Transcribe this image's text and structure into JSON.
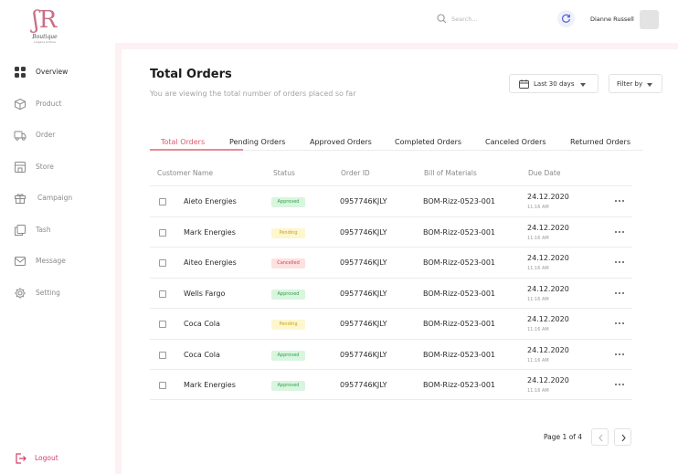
{
  "brand": {
    "name": "Boutique",
    "tagline": "Lingerie & More"
  },
  "header": {
    "search_placeholder": "Search...",
    "user_name": "Dianne Russell"
  },
  "sidebar": {
    "items": [
      {
        "label": "Overview",
        "icon": "grid-icon",
        "active": true
      },
      {
        "label": "Product",
        "icon": "box-icon",
        "active": false
      },
      {
        "label": "Order",
        "icon": "truck-icon",
        "active": false
      },
      {
        "label": "Store",
        "icon": "store-icon",
        "active": false
      },
      {
        "label": "Campaign",
        "icon": "gift-icon",
        "active": false
      },
      {
        "label": "Tash",
        "icon": "copy-icon",
        "active": false
      },
      {
        "label": "Message",
        "icon": "mail-icon",
        "active": false
      },
      {
        "label": "Setting",
        "icon": "gear-icon",
        "active": false
      }
    ],
    "logout_label": "Logout"
  },
  "page": {
    "title": "Total Orders",
    "subtitle": "You are viewing the total number of orders placed so far",
    "date_filter_label": "Last 30 days",
    "filter_label": "Filter by"
  },
  "tabs": [
    {
      "label": "Total Orders",
      "active": true
    },
    {
      "label": "Pending Orders",
      "active": false
    },
    {
      "label": "Approved Orders",
      "active": false
    },
    {
      "label": "Completed Orders",
      "active": false
    },
    {
      "label": "Canceled Orders",
      "active": false
    },
    {
      "label": "Returned Orders",
      "active": false
    }
  ],
  "table": {
    "columns": [
      "Customer Name",
      "Status",
      "Order ID",
      "Bill of Materials",
      "Due Date"
    ],
    "rows": [
      {
        "customer": "Aieto Energies",
        "status": "Approved",
        "status_kind": "approved",
        "order_id": "0957746KJLY",
        "bom": "BOM-Rizz-0523-001",
        "due_date": "24.12.2020",
        "due_time": "11:16 AM"
      },
      {
        "customer": "Mark Energies",
        "status": "Pending",
        "status_kind": "pending",
        "order_id": "0957746KJLY",
        "bom": "BOM-Rizz-0523-001",
        "due_date": "24.12.2020",
        "due_time": "11:16 AM"
      },
      {
        "customer": "Aiteo Energies",
        "status": "Cancelled",
        "status_kind": "cancelled",
        "order_id": "0957746KJLY",
        "bom": "BOM-Rizz-0523-001",
        "due_date": "24.12.2020",
        "due_time": "11:16 AM"
      },
      {
        "customer": "Wells Fargo",
        "status": "Approved",
        "status_kind": "approved",
        "order_id": "0957746KJLY",
        "bom": "BOM-Rizz-0523-001",
        "due_date": "24.12.2020",
        "due_time": "11:16 AM"
      },
      {
        "customer": "Coca Cola",
        "status": "Pending",
        "status_kind": "pending",
        "order_id": "0957746KJLY",
        "bom": "BOM-Rizz-0523-001",
        "due_date": "24.12.2020",
        "due_time": "11:16 AM"
      },
      {
        "customer": "Coca Cola",
        "status": "Approved",
        "status_kind": "approved",
        "order_id": "0957746KJLY",
        "bom": "BOM-Rizz-0523-001",
        "due_date": "24.12.2020",
        "due_time": "11:16 AM"
      },
      {
        "customer": "Mark Energies",
        "status": "Approved",
        "status_kind": "approved",
        "order_id": "0957746KJLY",
        "bom": "BOM-Rizz-0523-001",
        "due_date": "24.12.2020",
        "due_time": "11:16 AM"
      }
    ]
  },
  "pagination": {
    "label": "Page 1 of 4"
  },
  "colors": {
    "accent": "#e0596f",
    "logout": "#d2406a",
    "approved": "#2fa24a",
    "pending": "#c9a21a",
    "cancelled": "#d64545",
    "main_frame": "#fdf1f3"
  }
}
